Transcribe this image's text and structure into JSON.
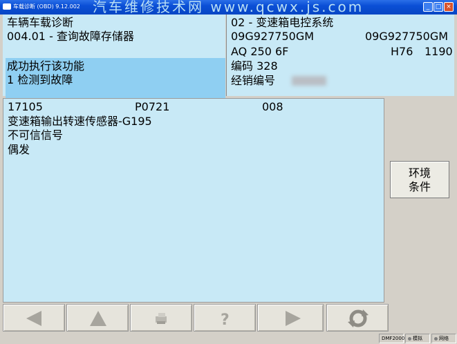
{
  "window": {
    "title": "车载诊断 (OBD)  9.12.002",
    "watermark": "汽车维修技术网 www.qcwx.js.com",
    "controls": {
      "minimize": "_",
      "maximize": "□",
      "close": "×"
    }
  },
  "left_panel": {
    "line1": "车辆车载诊断",
    "line2": "004.01 - 查询故障存储器",
    "line3": "成功执行该功能",
    "line4": "1 检测到故障"
  },
  "right_panel": {
    "system": "02 - 变速箱电控系统",
    "part_no_left": "09G927750GM",
    "part_no_right": "09G927750GM",
    "component": "AQ 250 6F",
    "hw": "H76",
    "sw": "1190",
    "code_label": "编码 328",
    "dealer_label": "经销编号"
  },
  "fault": {
    "code": "17105",
    "pcode": "P0721",
    "status_code": "008",
    "description": "变速箱输出转速传感器-G195",
    "symptom": "不可信信号",
    "type": "偶发"
  },
  "side": {
    "env_line1": "环境",
    "env_line2": "条件"
  },
  "toolbar": {
    "icons": [
      "back-arrow-icon",
      "up-arrow-icon",
      "print-icon",
      "help-icon",
      "forward-arrow-icon",
      "refresh-icon"
    ]
  },
  "status": {
    "version": "DMF2000",
    "mode": "模拟",
    "gateway": "网络"
  }
}
